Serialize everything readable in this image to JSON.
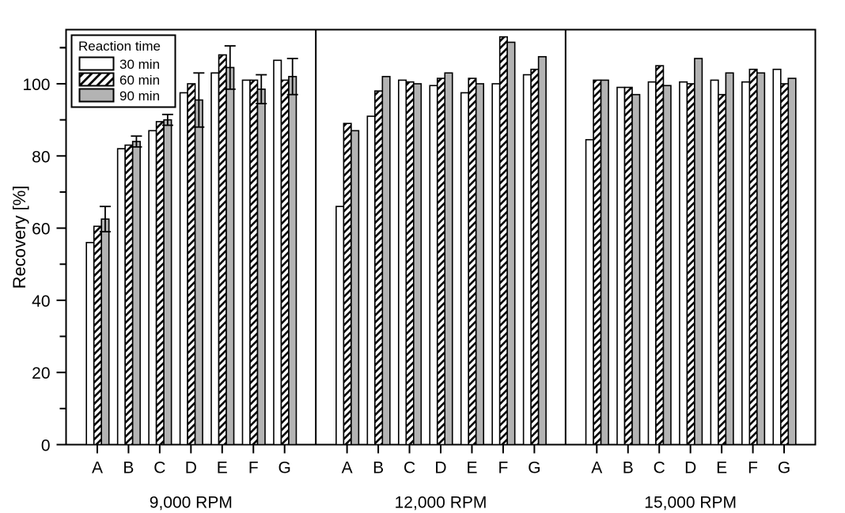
{
  "chart_data": {
    "type": "bar",
    "title": "",
    "xlabel": "",
    "ylabel": "Recovery [%]",
    "ylim": [
      0,
      115
    ],
    "yticks": [
      0,
      20,
      40,
      60,
      80,
      100
    ],
    "yminor_step": 10,
    "grid": false,
    "legend": {
      "title": "Reaction time",
      "position": "top-left-inside",
      "entries": [
        {
          "name": "30 min",
          "fill": "white",
          "pattern": "solid"
        },
        {
          "name": "60 min",
          "fill": "white",
          "pattern": "diagonal-hatch"
        },
        {
          "name": "90 min",
          "fill": "#b3b3b3",
          "pattern": "solid"
        }
      ]
    },
    "categories": [
      "A",
      "B",
      "C",
      "D",
      "E",
      "F",
      "G"
    ],
    "groups": [
      {
        "name": "9,000 RPM",
        "series": [
          {
            "name": "30 min",
            "values": [
              56.0,
              82.0,
              87.0,
              97.5,
              103.0,
              101.0,
              106.5
            ],
            "errors": [
              0.0,
              0.0,
              0.0,
              0.0,
              0.0,
              0.0,
              0.0
            ]
          },
          {
            "name": "60 min",
            "values": [
              60.5,
              83.0,
              89.5,
              100.0,
              108.0,
              101.0,
              101.0
            ],
            "errors": [
              0.0,
              0.0,
              0.0,
              0.0,
              0.0,
              0.0,
              0.0
            ]
          },
          {
            "name": "90 min",
            "values": [
              62.5,
              84.0,
              90.0,
              95.5,
              104.5,
              98.5,
              102.0
            ],
            "errors": [
              3.5,
              1.5,
              1.5,
              7.5,
              6.0,
              4.0,
              5.0
            ]
          }
        ]
      },
      {
        "name": "12,000 RPM",
        "series": [
          {
            "name": "30 min",
            "values": [
              66.0,
              91.0,
              101.0,
              99.5,
              97.5,
              100.0,
              102.5
            ],
            "errors": [
              0.0,
              0.0,
              0.0,
              0.0,
              0.0,
              0.0,
              0.0
            ]
          },
          {
            "name": "60 min",
            "values": [
              89.0,
              98.0,
              100.5,
              101.5,
              101.5,
              113.0,
              104.0
            ],
            "errors": [
              0.0,
              0.0,
              0.0,
              0.0,
              0.0,
              0.0,
              0.0
            ]
          },
          {
            "name": "90 min",
            "values": [
              87.0,
              102.0,
              100.0,
              103.0,
              100.0,
              111.5,
              107.5
            ],
            "errors": [
              0.0,
              0.0,
              0.0,
              0.0,
              0.0,
              0.0,
              0.0
            ]
          }
        ]
      },
      {
        "name": "15,000 RPM",
        "series": [
          {
            "name": "30 min",
            "values": [
              84.5,
              99.0,
              100.5,
              100.5,
              101.0,
              100.5,
              104.0
            ],
            "errors": [
              0.0,
              0.0,
              0.0,
              0.0,
              0.0,
              0.0,
              0.0
            ]
          },
          {
            "name": "60 min",
            "values": [
              101.0,
              99.0,
              105.0,
              100.0,
              97.0,
              104.0,
              100.0
            ],
            "errors": [
              0.0,
              0.0,
              0.0,
              0.0,
              0.0,
              0.0,
              0.0
            ]
          },
          {
            "name": "90 min",
            "values": [
              101.0,
              97.0,
              99.5,
              107.0,
              103.0,
              103.0,
              101.5
            ],
            "errors": [
              0.0,
              0.0,
              0.0,
              0.0,
              0.0,
              0.0,
              0.0
            ]
          }
        ]
      }
    ]
  },
  "axis": {
    "y_title": "Recovery [%]",
    "y_tick_labels": [
      "0",
      "20",
      "40",
      "60",
      "80",
      "100"
    ]
  }
}
